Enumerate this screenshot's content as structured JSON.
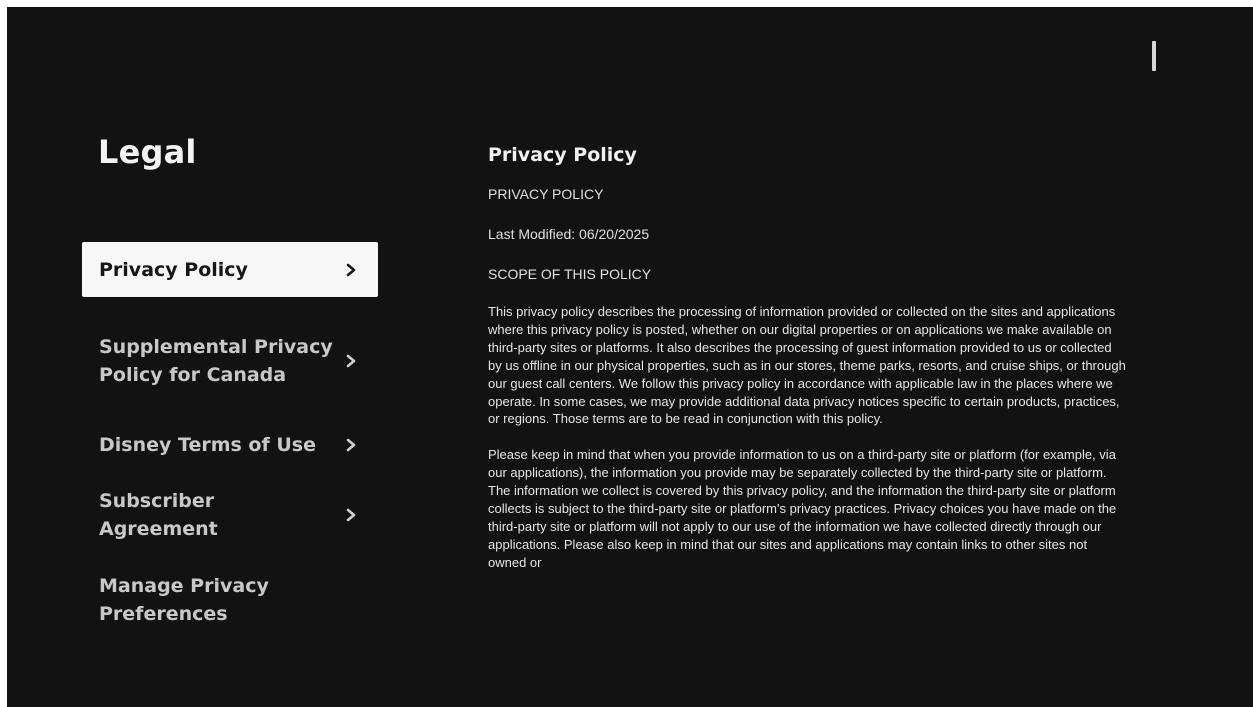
{
  "legal": {
    "title": "Legal",
    "nav": [
      {
        "label": "Privacy Policy",
        "icon": "chevron-right-icon",
        "active": true
      },
      {
        "label": "Supplemental Privacy Policy for Canada",
        "icon": "chevron-right-icon",
        "active": false
      },
      {
        "label": "Disney Terms of Use",
        "icon": "chevron-right-icon",
        "active": false
      },
      {
        "label": "Subscriber Agreement",
        "icon": "chevron-right-icon",
        "active": false
      },
      {
        "label": "Manage Privacy Preferences",
        "icon": "",
        "active": false
      }
    ]
  },
  "document": {
    "title": "Privacy Policy",
    "heading": "PRIVACY POLICY",
    "last_modified": "Last Modified: 06/20/2025",
    "scope_heading": "SCOPE OF THIS POLICY",
    "paragraph_1": "This privacy policy describes the processing of information provided or collected on the sites and applications where this privacy policy is posted, whether on our digital properties or on applications we make available on third-party sites or platforms. It also describes the processing of guest information provided to us or collected by us offline in our physical properties, such as in our stores, theme parks, resorts, and cruise ships, or through our guest call centers. We follow this privacy policy in accordance with applicable law in the places where we operate. In some cases, we may provide additional data privacy notices specific to certain products, practices, or regions. Those terms are to be read in conjunction with this policy.",
    "paragraph_2": "Please keep in mind that when you provide information to us on a third-party site or platform (for example, via our applications), the information you provide may be separately collected by the third-party site or platform. The information we collect is covered by this privacy policy, and the information the third-party site or platform collects is subject to the third-party site or platform's privacy practices. Privacy choices you have made on the third-party site or platform will not apply to our use of the information we have collected directly through our applications. Please also keep in mind that our sites and applications may contain links to other sites not owned or"
  },
  "theme": {
    "background": "#121214",
    "active_item_bg": "#f7f7f7",
    "active_item_text": "#17171a",
    "inactive_item_text": "#c8c8c8"
  }
}
